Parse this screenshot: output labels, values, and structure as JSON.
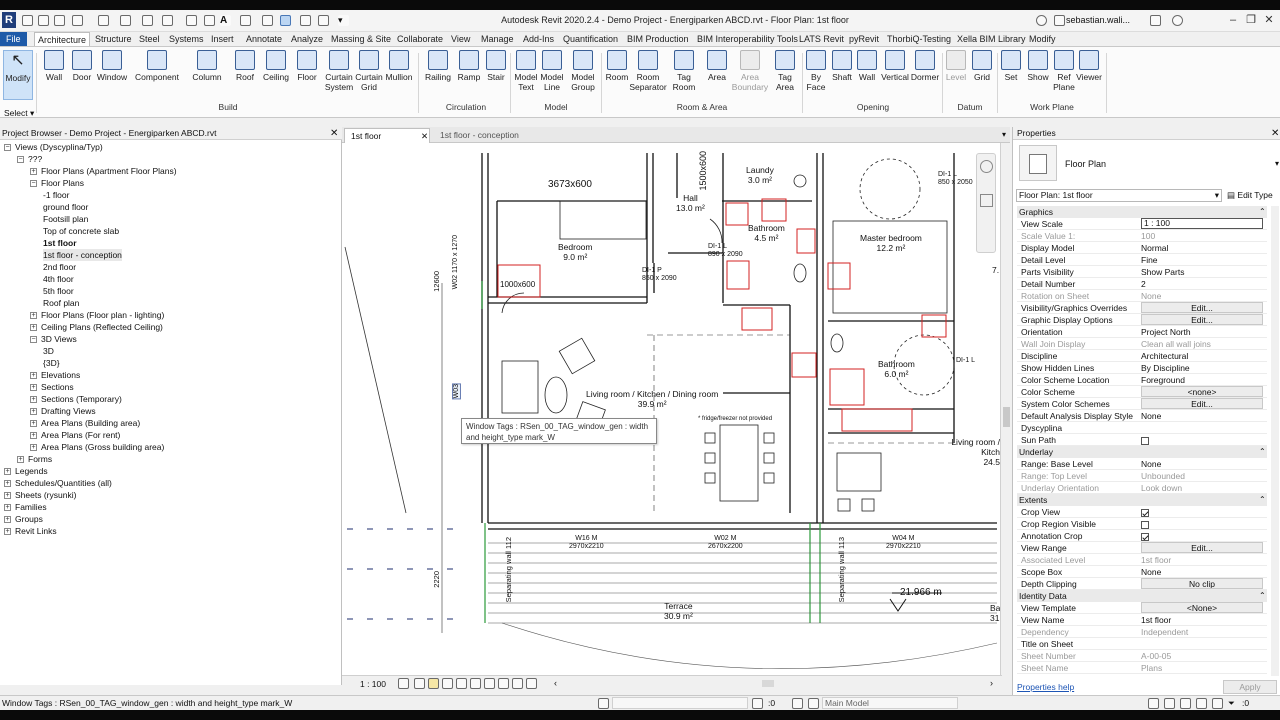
{
  "app": {
    "title": "Autodesk Revit 2020.2.4 - Demo Project - Energiparken ABCD.rvt - Floor Plan: 1st floor",
    "user": "sebastian.wali...",
    "logo": "R"
  },
  "ribbon_tabs": [
    "File",
    "Architecture",
    "Structure",
    "Steel",
    "Systems",
    "Insert",
    "Annotate",
    "Analyze",
    "Massing & Site",
    "Collaborate",
    "View",
    "Manage",
    "Add-Ins",
    "Quantification",
    "BIM Production",
    "BIM Interoperability Tools",
    "LATS Revit",
    "pyRevit",
    "ThorbiQ-Testing",
    "Xella BIM Library",
    "Modify"
  ],
  "ribbon": {
    "modify": "Modify",
    "select": "Select",
    "tools": {
      "wall": "Wall",
      "door": "Door",
      "window": "Window",
      "component": "Component",
      "column": "Column",
      "roof": "Roof",
      "ceiling": "Ceiling",
      "floor": "Floor",
      "curtain_system": "Curtain\nSystem",
      "curtain_grid": "Curtain\nGrid",
      "mullion": "Mullion",
      "railing": "Railing",
      "ramp": "Ramp",
      "stair": "Stair",
      "model_text": "Model\nText",
      "model_line": "Model\nLine",
      "model_group": "Model\nGroup",
      "room": "Room",
      "room_separator": "Room\nSeparator",
      "tag_room": "Tag\nRoom",
      "area": "Area",
      "area_boundary": "Area\nBoundary",
      "tag_area": "Tag\nArea",
      "by_face": "By\nFace",
      "shaft": "Shaft",
      "wall_op": "Wall",
      "vertical": "Vertical",
      "dormer": "Dormer",
      "level": "Level",
      "grid": "Grid",
      "set": "Set",
      "show": "Show",
      "ref_plane": "Ref\nPlane",
      "viewer": "Viewer"
    },
    "panels": {
      "build": "Build",
      "circulation": "Circulation",
      "model": "Model",
      "room_area": "Room & Area",
      "opening": "Opening",
      "datum": "Datum",
      "work_plane": "Work Plane"
    }
  },
  "project_browser": {
    "title": "Project Browser - Demo Project - Energiparken ABCD.rvt",
    "items": [
      {
        "label": "Views (Dyscyplina/Typ)",
        "indent": 0
      },
      {
        "label": "???",
        "indent": 1
      },
      {
        "label": "Floor Plans (Apartment Floor Plans)",
        "indent": 2
      },
      {
        "label": "Floor Plans",
        "indent": 2
      },
      {
        "label": "-1 floor",
        "indent": 3
      },
      {
        "label": "ground floor",
        "indent": 3
      },
      {
        "label": "Footsill plan",
        "indent": 3
      },
      {
        "label": "Top of concrete slab",
        "indent": 3
      },
      {
        "label": "1st floor",
        "indent": 3
      },
      {
        "label": "1st floor - conception",
        "indent": 3
      },
      {
        "label": "2nd floor",
        "indent": 3
      },
      {
        "label": "4th floor",
        "indent": 3
      },
      {
        "label": "5th floor",
        "indent": 3
      },
      {
        "label": "Roof plan",
        "indent": 3
      },
      {
        "label": "Floor Plans (Floor plan - lighting)",
        "indent": 2
      },
      {
        "label": "Ceiling Plans (Reflected Ceiling)",
        "indent": 2
      },
      {
        "label": "3D Views",
        "indent": 2
      },
      {
        "label": "3D",
        "indent": 3
      },
      {
        "label": "{3D}",
        "indent": 3
      },
      {
        "label": "Elevations",
        "indent": 2
      },
      {
        "label": "Sections",
        "indent": 2
      },
      {
        "label": "Sections (Temporary)",
        "indent": 2
      },
      {
        "label": "Drafting Views",
        "indent": 2
      },
      {
        "label": "Area Plans (Building area)",
        "indent": 2
      },
      {
        "label": "Area Plans (For rent)",
        "indent": 2
      },
      {
        "label": "Area Plans (Gross building area)",
        "indent": 2
      },
      {
        "label": "Forms",
        "indent": 1
      },
      {
        "label": "Legends",
        "indent": 0
      },
      {
        "label": "Schedules/Quantities (all)",
        "indent": 0
      },
      {
        "label": "Sheets (rysunki)",
        "indent": 0
      },
      {
        "label": "Families",
        "indent": 0
      },
      {
        "label": "Groups",
        "indent": 0
      },
      {
        "label": "Revit Links",
        "indent": 0
      }
    ]
  },
  "view_tabs": [
    "1st floor",
    "1st floor - conception"
  ],
  "canvas": {
    "rooms": [
      {
        "name": "Laundy",
        "area": "3.0 m²"
      },
      {
        "name": "Hall",
        "area": "13.0 m²"
      },
      {
        "name": "Bathroom",
        "area": "4.5 m²"
      },
      {
        "name": "Bedroom",
        "area": "9.0 m²"
      },
      {
        "name": "Master bedroom",
        "area": "12.2 m²"
      },
      {
        "name": "Living room / Kitchen / Dining room",
        "area": "39.9 m²"
      },
      {
        "name": "Bathroom",
        "area": "6.0 m²"
      },
      {
        "name": "Terrace",
        "area": "30.9 m²"
      },
      {
        "name": "Living room / Kitch",
        "area": "24.5"
      }
    ],
    "labels": {
      "dim1": "3673x600",
      "dim2": "1500x600",
      "dim3": "1000x600",
      "door1": "DI-1 P",
      "door1b": "850 x 2090",
      "door2": "DI-1 L",
      "door2b": "890 x 2090",
      "door3": "DI-1 L",
      "door3b": "850 x 2050",
      "door4": "DI-1 L",
      "win_w02": "W02",
      "win_w02b": "1170 x 1270",
      "win_w03": "W03",
      "win_w16": "W16 M",
      "win_w16b": "2970x2210",
      "win_w02m": "W02 M",
      "win_w02mb": "2670x2200",
      "win_w04": "W04 M",
      "win_w04b": "2970x2210",
      "fridge": "* fridge/freezer not provided",
      "sep1": "Separating wall 112",
      "sep2": "Separating wall 113",
      "elev": "21.966 m",
      "dim_12600": "12600",
      "dim_2220": "2220",
      "ba": "Ba",
      "n31": "31",
      "n7": "7."
    },
    "tooltip": "Window Tags : RSen_00_TAG_window_gen : width and height_type mark_W"
  },
  "view_control": {
    "scale": "1 : 100"
  },
  "properties": {
    "title": "Properties",
    "type_name": "Floor Plan",
    "selector": "Floor Plan: 1st floor",
    "edit_type": "Edit Type",
    "help": "Properties help",
    "apply": "Apply",
    "groups": [
      {
        "name": "Graphics",
        "rows": [
          {
            "k": "View Scale",
            "v": "1 : 100",
            "kind": "input"
          },
          {
            "k": "Scale Value    1:",
            "v": "100",
            "kind": "dis"
          },
          {
            "k": "Display Model",
            "v": "Normal"
          },
          {
            "k": "Detail Level",
            "v": "Fine"
          },
          {
            "k": "Parts Visibility",
            "v": "Show Parts"
          },
          {
            "k": "Detail Number",
            "v": "2"
          },
          {
            "k": "Rotation on Sheet",
            "v": "None",
            "kind": "dis"
          },
          {
            "k": "Visibility/Graphics Overrides",
            "v": "Edit...",
            "kind": "btn"
          },
          {
            "k": "Graphic Display Options",
            "v": "Edit...",
            "kind": "btn"
          },
          {
            "k": "Orientation",
            "v": "Project North"
          },
          {
            "k": "Wall Join Display",
            "v": "Clean all wall joins",
            "kind": "dis"
          },
          {
            "k": "Discipline",
            "v": "Architectural"
          },
          {
            "k": "Show Hidden Lines",
            "v": "By Discipline"
          },
          {
            "k": "Color Scheme Location",
            "v": "Foreground"
          },
          {
            "k": "Color Scheme",
            "v": "<none>",
            "kind": "btn"
          },
          {
            "k": "System Color Schemes",
            "v": "Edit...",
            "kind": "btn"
          },
          {
            "k": "Default Analysis Display Style",
            "v": "None"
          },
          {
            "k": "Dyscyplina",
            "v": ""
          },
          {
            "k": "Sun Path",
            "v": "",
            "kind": "cb"
          }
        ]
      },
      {
        "name": "Underlay",
        "rows": [
          {
            "k": "Range: Base Level",
            "v": "None"
          },
          {
            "k": "Range: Top Level",
            "v": "Unbounded",
            "kind": "dis"
          },
          {
            "k": "Underlay Orientation",
            "v": "Look down",
            "kind": "dis"
          }
        ]
      },
      {
        "name": "Extents",
        "rows": [
          {
            "k": "Crop View",
            "v": "",
            "kind": "cbon"
          },
          {
            "k": "Crop Region Visible",
            "v": "",
            "kind": "cb"
          },
          {
            "k": "Annotation Crop",
            "v": "",
            "kind": "cbon"
          },
          {
            "k": "View Range",
            "v": "Edit...",
            "kind": "btn"
          },
          {
            "k": "Associated Level",
            "v": "1st floor",
            "kind": "dis"
          },
          {
            "k": "Scope Box",
            "v": "None"
          },
          {
            "k": "Depth Clipping",
            "v": "No clip",
            "kind": "btn"
          }
        ]
      },
      {
        "name": "Identity Data",
        "rows": [
          {
            "k": "View Template",
            "v": "<None>",
            "kind": "btn"
          },
          {
            "k": "View Name",
            "v": "1st floor"
          },
          {
            "k": "Dependency",
            "v": "Independent",
            "kind": "dis"
          },
          {
            "k": "Title on Sheet",
            "v": ""
          },
          {
            "k": "Sheet Number",
            "v": "A-00-05",
            "kind": "dis"
          },
          {
            "k": "Sheet Name",
            "v": "Plans",
            "kind": "dis"
          }
        ]
      }
    ]
  },
  "status_bar": {
    "message": "Window Tags : RSen_00_TAG_window_gen : width and height_type mark_W",
    "zero": ":0",
    "model": "Main Model",
    "filter": ":0"
  }
}
